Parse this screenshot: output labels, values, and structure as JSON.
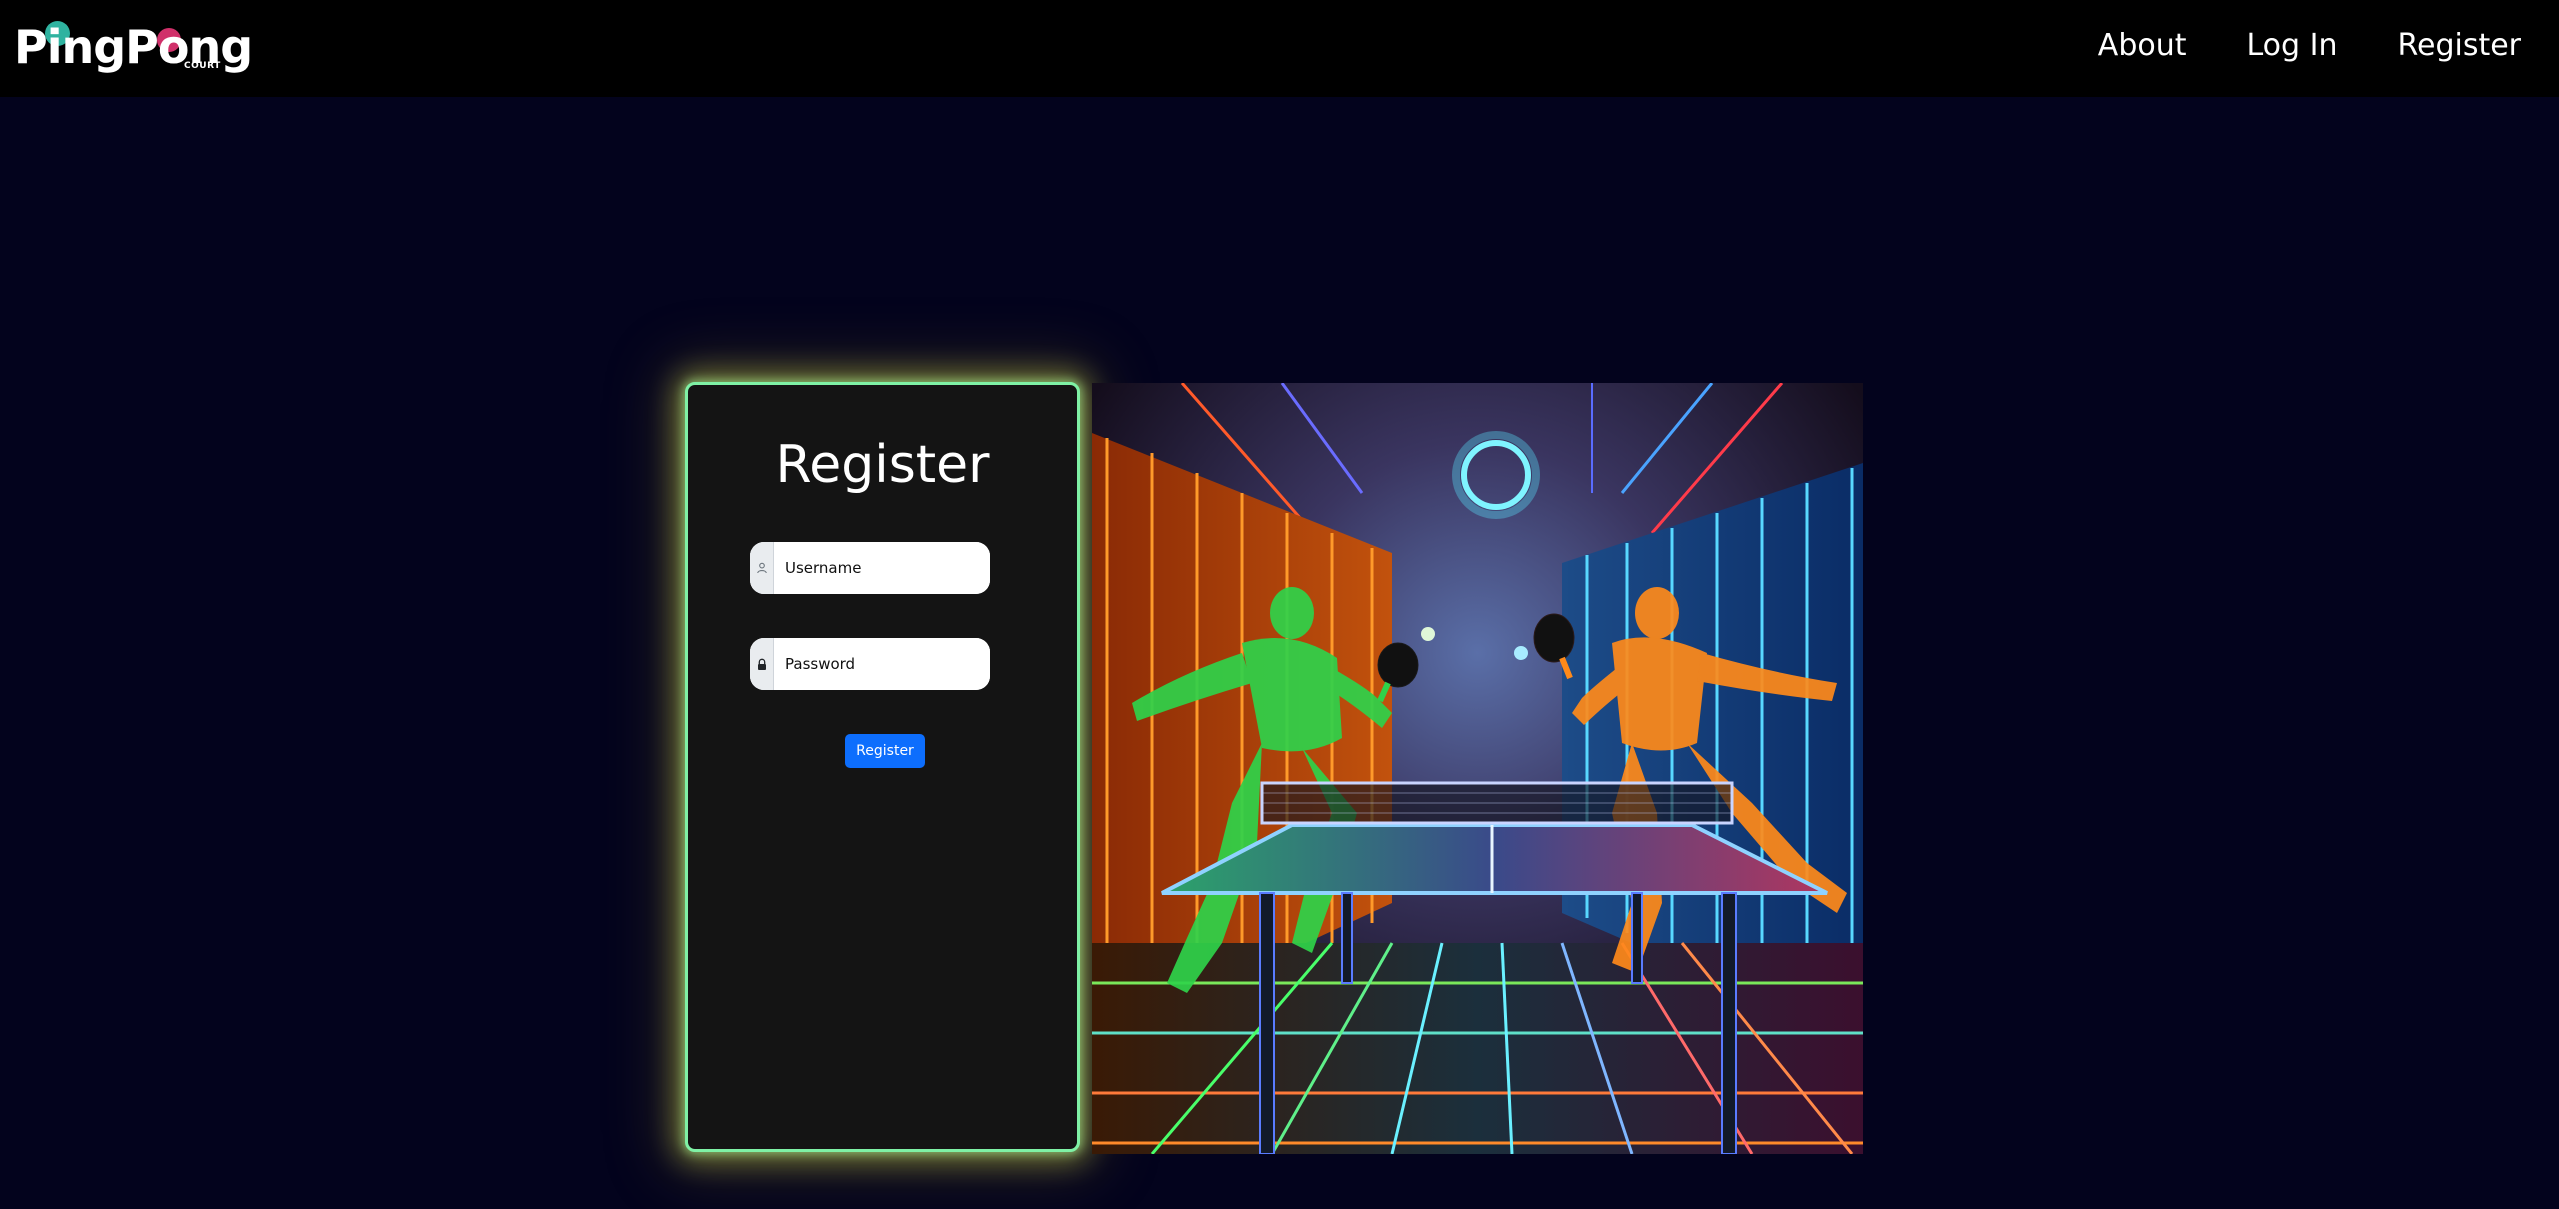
{
  "brand": {
    "logo_text": "PingPong",
    "logo_subtext": "COURT"
  },
  "nav": {
    "about": "About",
    "login": "Log In",
    "register": "Register"
  },
  "form": {
    "title": "Register",
    "username": {
      "placeholder": "Username",
      "value": ""
    },
    "password": {
      "placeholder": "Password",
      "value": ""
    },
    "submit_label": "Register"
  },
  "hero_image": {
    "description_icon": "neon-ping-pong-players-image"
  },
  "colors": {
    "page_bg": "#03031d",
    "nav_bg": "#000000",
    "card_bg": "#141414",
    "card_border": "#7ff1a5",
    "button": "#0d6efd",
    "logo_teal": "#2fb3a0",
    "logo_pink": "#d0306a"
  }
}
